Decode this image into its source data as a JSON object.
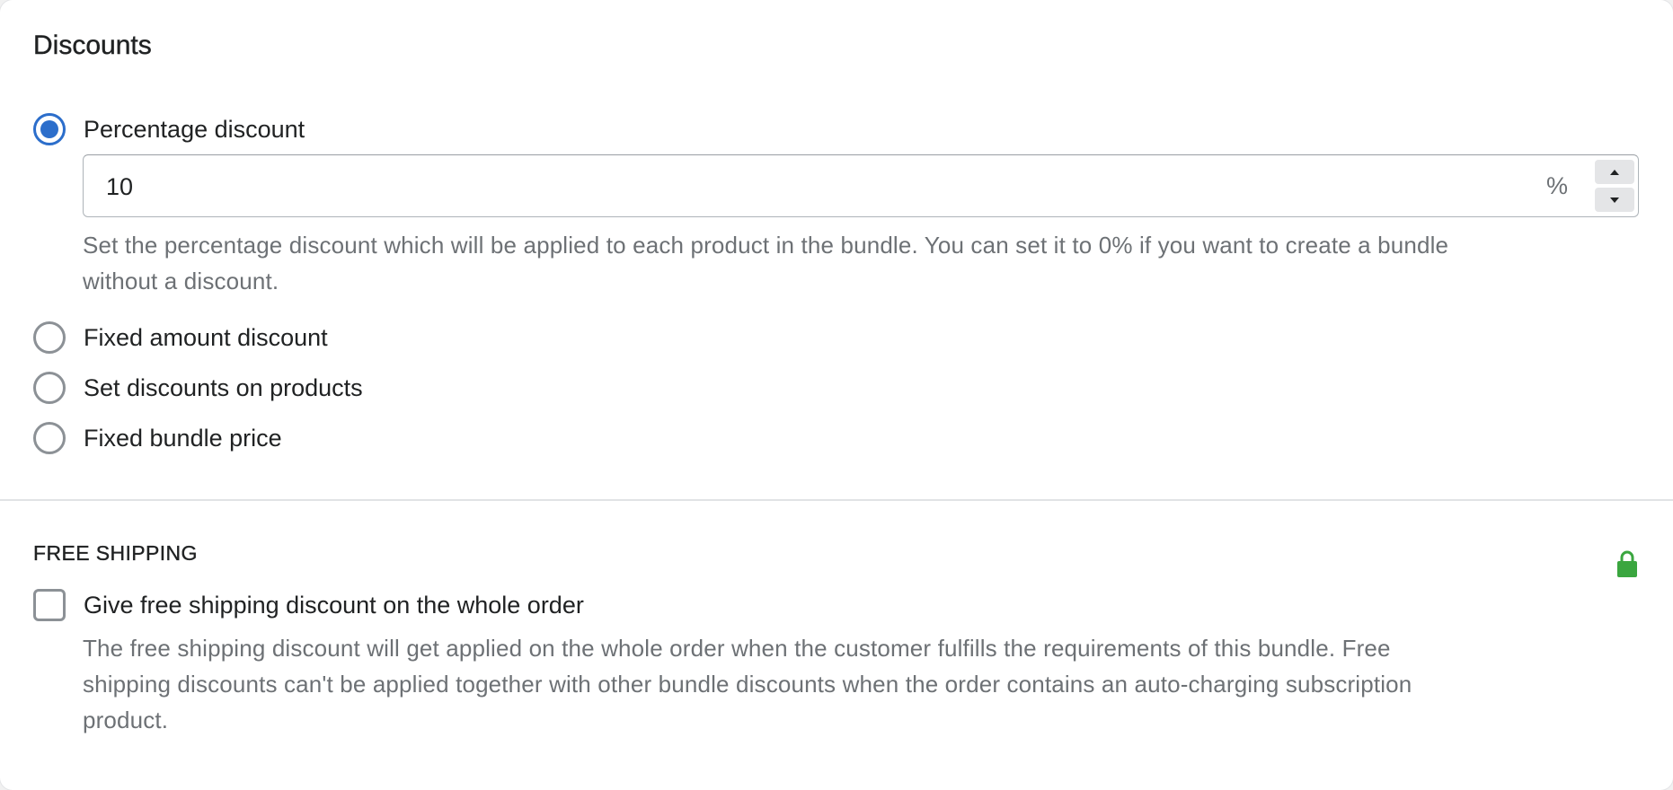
{
  "discounts": {
    "title": "Discounts",
    "options": [
      {
        "label": "Percentage discount",
        "checked": true
      },
      {
        "label": "Fixed amount discount",
        "checked": false
      },
      {
        "label": "Set discounts on products",
        "checked": false
      },
      {
        "label": "Fixed bundle price",
        "checked": false
      }
    ],
    "percentage_field": {
      "value": "10",
      "suffix": "%"
    },
    "help_line_1": "Set the percentage discount which will be applied to each product in the bundle. You can set it to 0% if you want to create a bundle",
    "help_line_2": "without a discount."
  },
  "free_shipping": {
    "title": "FREE SHIPPING",
    "lock_icon": "lock-icon",
    "lock_color": "#3aa63f",
    "checkbox_label": "Give free shipping discount on the whole order",
    "checkbox_checked": false,
    "help_line_1": "The free shipping discount will get applied on the whole order when the customer fulfills the requirements of this bundle. Free",
    "help_line_2": "shipping discounts can't be applied together with other bundle discounts when the order contains an auto-charging subscription",
    "help_line_3": "product."
  },
  "colors": {
    "accent": "#2c6ecb",
    "subdued_text": "#6d7175",
    "text": "#202223"
  }
}
